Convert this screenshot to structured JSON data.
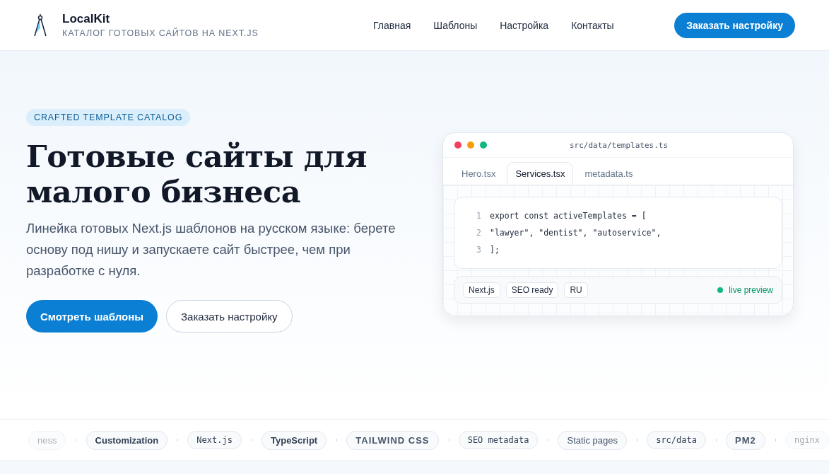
{
  "header": {
    "brand": "LocalKit",
    "tagline": "КАТАЛОГ ГОТОВЫХ САЙТОВ НА NEXT.JS",
    "nav": [
      "Главная",
      "Шаблоны",
      "Настройка",
      "Контакты"
    ],
    "cta": "Заказать настройку"
  },
  "hero": {
    "badge": "CRAFTED TEMPLATE CATALOG",
    "title": "Готовые сайты для малого бизнеса",
    "lead": "Линейка готовых Next.js шаблонов на русском языке: берете основу под нишу и запускаете сайт быстрее, чем при разработке с нуля.",
    "primary": "Смотреть шаблоны",
    "secondary": "Заказать настройку"
  },
  "editor": {
    "path": "src/data/templates.ts",
    "tabs": [
      {
        "label": "Hero.tsx",
        "selected": false
      },
      {
        "label": "Services.tsx",
        "selected": true
      },
      {
        "label": "metadata.ts",
        "selected": false
      }
    ],
    "lines": [
      {
        "num": "1",
        "code": "export const activeTemplates = ["
      },
      {
        "num": "2",
        "code": "\"lawyer\", \"dentist\", \"autoservice\","
      },
      {
        "num": "3",
        "code": "];"
      }
    ],
    "tags": [
      "Next.js",
      "SEO ready",
      "RU"
    ],
    "status": "live preview"
  },
  "marquee": [
    {
      "label": "ness",
      "kind": "plain",
      "faded": true
    },
    {
      "label": "Customization",
      "kind": "bold",
      "faded": false
    },
    {
      "label": "Next.js",
      "kind": "mono",
      "faded": false
    },
    {
      "label": "TypeScript",
      "kind": "bold",
      "faded": false
    },
    {
      "label": "TAILWIND CSS",
      "kind": "caps",
      "faded": false
    },
    {
      "label": "SEO metadata",
      "kind": "mono",
      "faded": false
    },
    {
      "label": "Static pages",
      "kind": "plain",
      "faded": false
    },
    {
      "label": "src/data",
      "kind": "mono",
      "faded": false
    },
    {
      "label": "PM2",
      "kind": "caps",
      "faded": false
    },
    {
      "label": "nginx",
      "kind": "mono",
      "faded": true
    }
  ]
}
